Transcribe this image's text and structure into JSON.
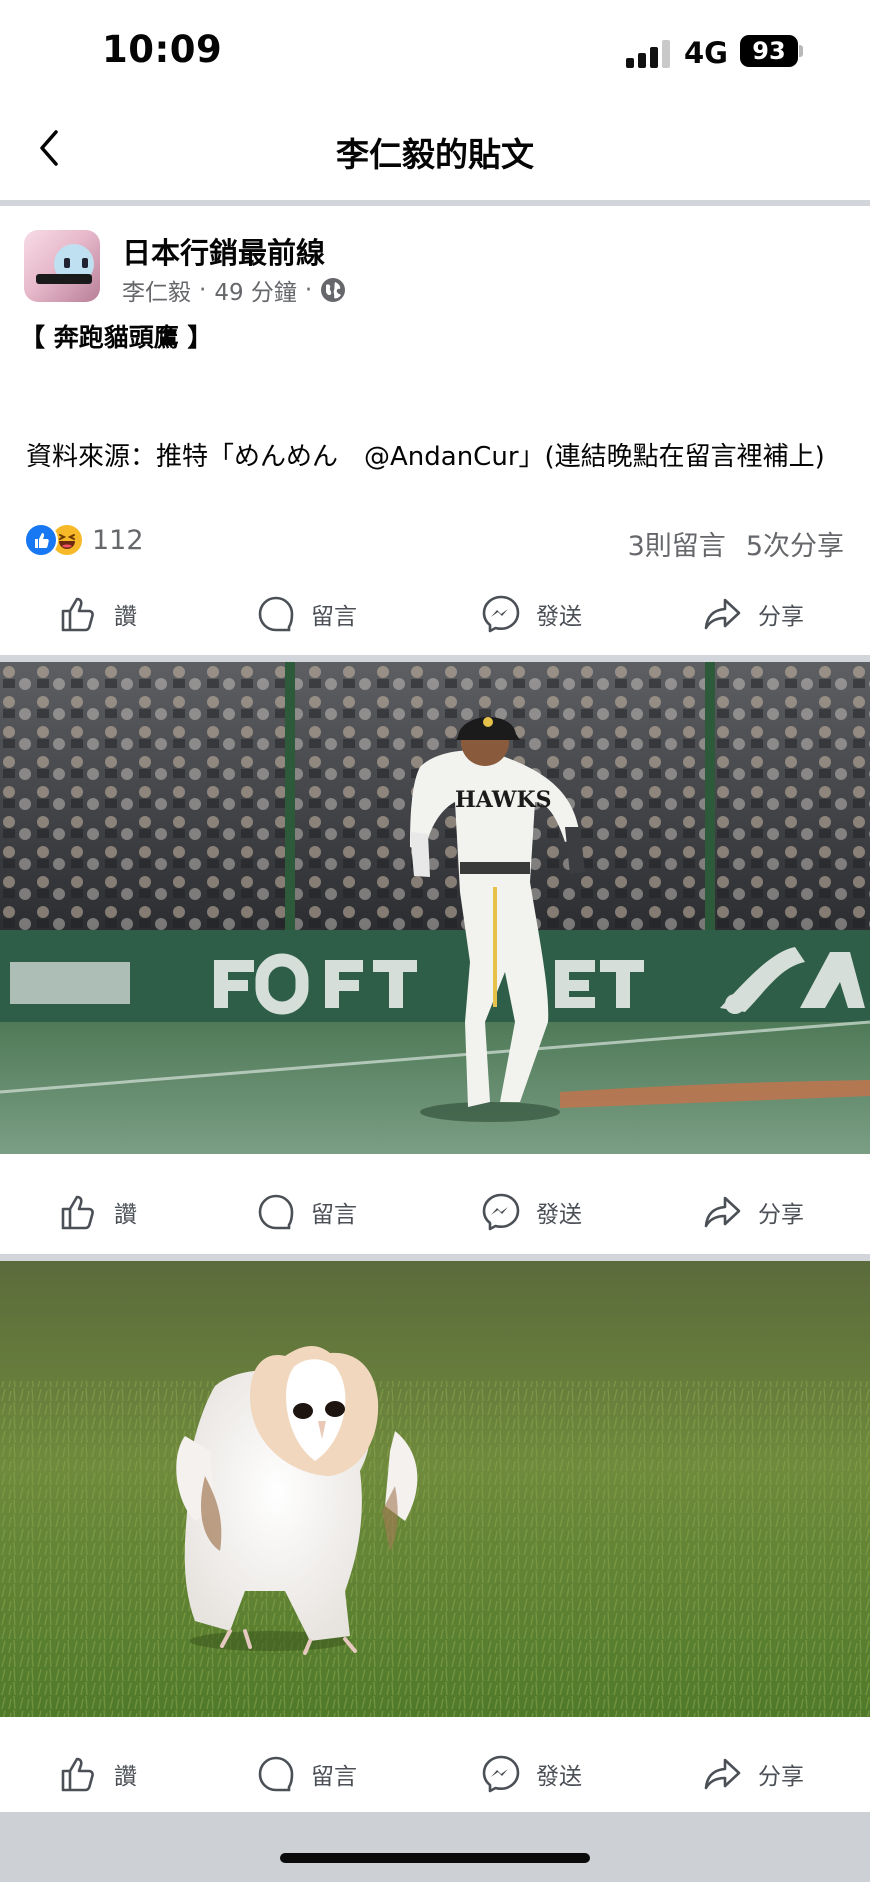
{
  "status_bar": {
    "time": "10:09",
    "network": "4G",
    "battery": "93"
  },
  "header": {
    "back_icon": "chevron-left-icon",
    "title": "李仁毅的貼文"
  },
  "post": {
    "page_name": "日本行銷最前線",
    "author": "李仁毅",
    "separator": "·",
    "time_ago": "49 分鐘",
    "privacy_icon": "globe-icon",
    "heading": "【 奔跑貓頭鷹 】",
    "source_text": "資料來源：推特「めんめん　@AndanCur」(連結晚點在留言裡補上)",
    "reactions": {
      "icons": [
        "like-reaction-icon",
        "haha-reaction-icon"
      ],
      "count": "112"
    },
    "comments": "3則留言",
    "shares": "5次分享"
  },
  "actions": {
    "like": "讚",
    "comment": "留言",
    "send": "發送",
    "share": "分享"
  },
  "colors": {
    "facebook_blue": "#1877f2",
    "haha_yellow": "#f7b928",
    "secondary_text": "#65676b",
    "divider": "#d2d5d9"
  }
}
